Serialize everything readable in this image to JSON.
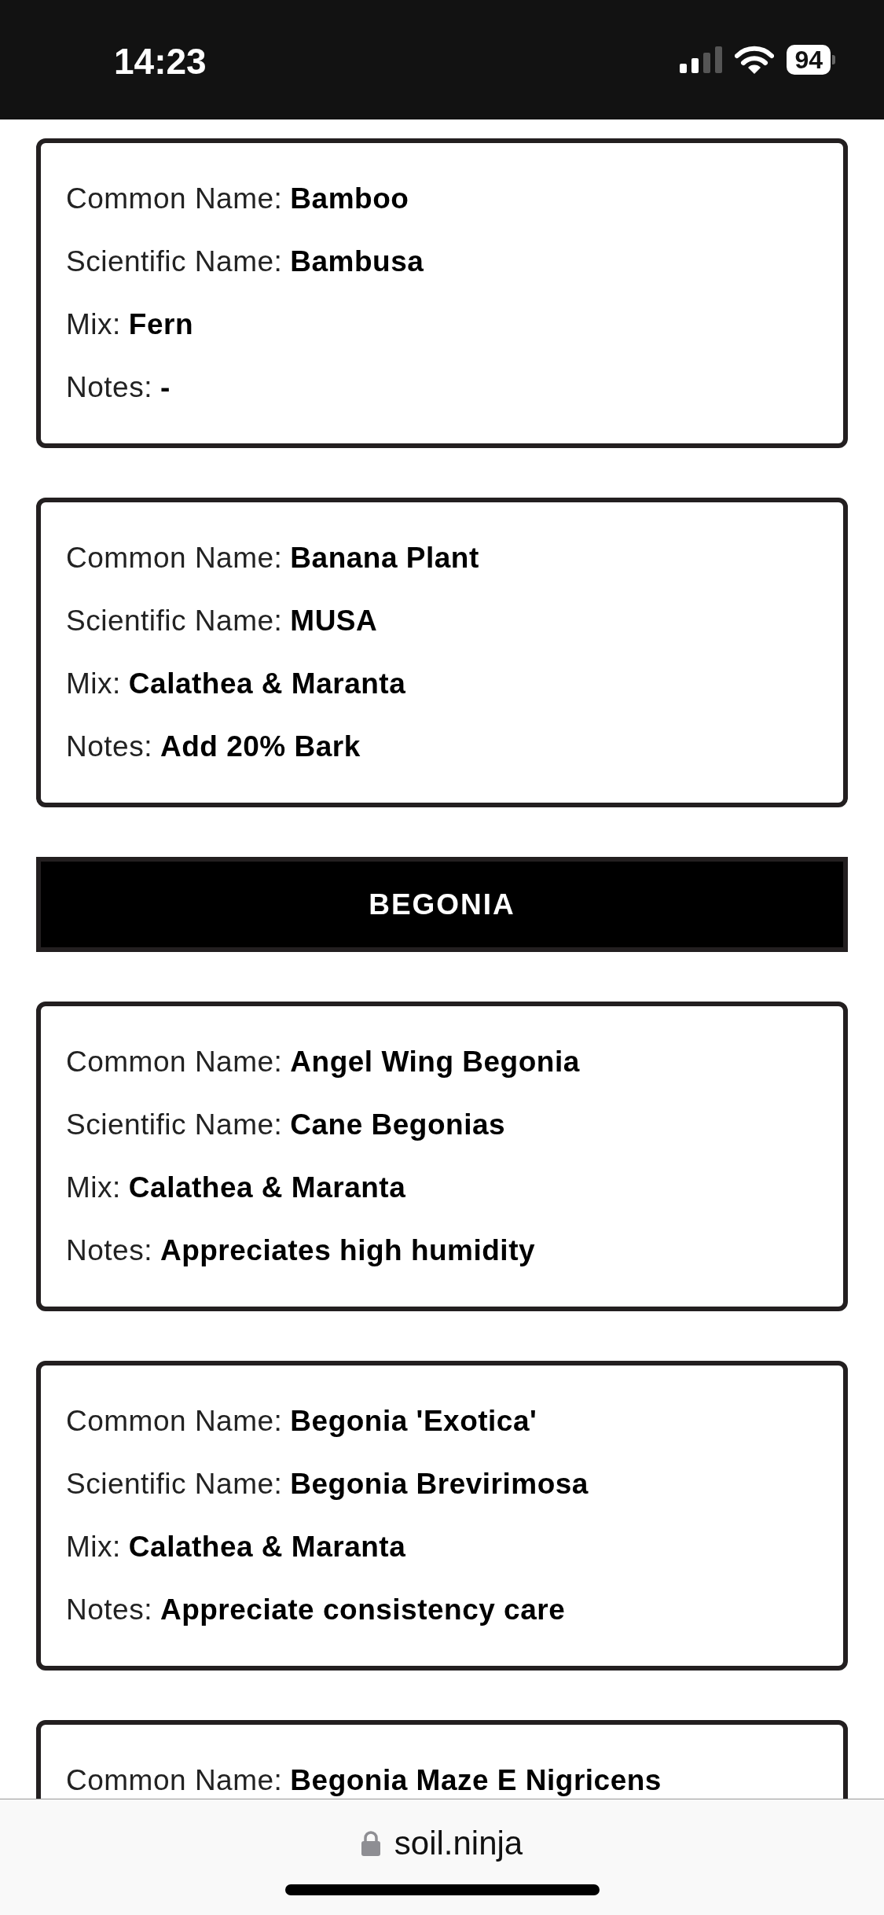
{
  "status_bar": {
    "time": "14:23",
    "battery": "94"
  },
  "items": [
    {
      "kind": "card",
      "fields": [
        {
          "label": "Common Name:",
          "value": "Bamboo"
        },
        {
          "label": "Scientific Name:",
          "value": "Bambusa"
        },
        {
          "label": "Mix:",
          "value": "Fern"
        },
        {
          "label": "Notes:",
          "value": "-"
        }
      ]
    },
    {
      "kind": "card",
      "fields": [
        {
          "label": "Common Name:",
          "value": "Banana Plant"
        },
        {
          "label": "Scientific Name:",
          "value": "MUSA"
        },
        {
          "label": "Mix:",
          "value": "Calathea & Maranta"
        },
        {
          "label": "Notes:",
          "value": "Add 20% Bark"
        }
      ]
    },
    {
      "kind": "header",
      "title": "BEGONIA"
    },
    {
      "kind": "card",
      "fields": [
        {
          "label": "Common Name:",
          "value": "Angel Wing Begonia"
        },
        {
          "label": "Scientific Name:",
          "value": "Cane Begonias"
        },
        {
          "label": "Mix:",
          "value": "Calathea & Maranta"
        },
        {
          "label": "Notes:",
          "value": "Appreciates high humidity"
        }
      ]
    },
    {
      "kind": "card",
      "fields": [
        {
          "label": "Common Name:",
          "value": "Begonia 'Exotica'"
        },
        {
          "label": "Scientific Name:",
          "value": "Begonia Brevirimosa"
        },
        {
          "label": "Mix:",
          "value": "Calathea & Maranta"
        },
        {
          "label": "Notes:",
          "value": "Appreciate consistency care"
        }
      ]
    },
    {
      "kind": "card",
      "fields": [
        {
          "label": "Common Name:",
          "value": "Begonia Maze E Nigricens"
        }
      ]
    }
  ],
  "browser_bar": {
    "url": "soil.ninja"
  }
}
